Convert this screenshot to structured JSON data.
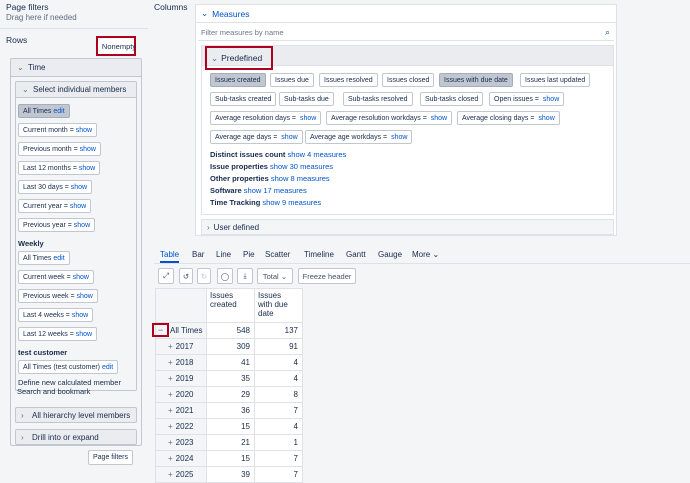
{
  "left": {
    "page_filters_title": "Page filters",
    "page_filters_hint": "Drag here if needed",
    "rows_title": "Rows",
    "nonempty_label": "Nonempty",
    "time_panel_title": "Time",
    "select_members_title": "Select individual members",
    "members": {
      "all_times": "All Times",
      "edit": "edit",
      "show": "show",
      "current_month": "Current month",
      "previous_month": "Previous month",
      "last_12_months": "Last 12 months",
      "last_30_days": "Last 30 days",
      "current_year": "Current year",
      "previous_year": "Previous year",
      "weekly_title": "Weekly",
      "current_week": "Current week",
      "previous_week": "Previous week",
      "last_4_weeks": "Last 4 weeks",
      "last_12_weeks": "Last 12 weeks",
      "test_customer_title": "test customer",
      "all_times_test_customer": "All Times (test customer)",
      "define_calc": "Define new calculated member",
      "search_bookmark": "Search and bookmark"
    },
    "all_hierarchy": "All hierarchy level members",
    "drill": "Drill into or expand",
    "page_filters_button": "Page filters"
  },
  "columns_label": "Columns",
  "measures": {
    "title": "Measures",
    "filter_placeholder": "Filter measures by name",
    "predefined_title": "Predefined",
    "show": "show",
    "chips": {
      "issues_created": "Issues created",
      "issues_due": "Issues due",
      "issues_resolved": "Issues resolved",
      "issues_closed": "Issues closed",
      "issues_with_due_date": "Issues with due date",
      "issues_last_updated": "Issues last updated",
      "subtasks_created": "Sub-tasks created",
      "subtasks_due": "Sub-tasks due",
      "subtasks_resolved": "Sub-tasks resolved",
      "subtasks_closed": "Sub-tasks closed",
      "open_issues": "Open issues",
      "avg_resolution_days": "Average resolution days",
      "avg_resolution_workdays": "Average resolution workdays",
      "avg_closing_days": "Average closing days",
      "avg_age_days": "Average age days",
      "avg_age_workdays": "Average age workdays"
    },
    "groups": [
      {
        "label": "Distinct issues count",
        "link": "show 4 measures"
      },
      {
        "label": "Issue properties",
        "link": "show 30 measures"
      },
      {
        "label": "Other properties",
        "link": "show 8 measures"
      },
      {
        "label": "Software",
        "link": "show 17 measures"
      },
      {
        "label": "Time Tracking",
        "link": "show 9 measures"
      }
    ],
    "user_defined_title": "User defined"
  },
  "tabs": [
    "Table",
    "Bar",
    "Line",
    "Pie",
    "Scatter",
    "Timeline",
    "Gantt",
    "Gauge",
    "More"
  ],
  "toolbar": {
    "total_label": "Total",
    "freeze_header": "Freeze header"
  },
  "table": {
    "col_headers": [
      "Issues\ncreated",
      "Issues\nwith due\ndate"
    ],
    "col1": "Issues created",
    "col2": "Issues with due date",
    "rows": [
      {
        "label": "All Times",
        "created": "548",
        "due": "137"
      },
      {
        "label": "2017",
        "created": "309",
        "due": "91"
      },
      {
        "label": "2018",
        "created": "41",
        "due": "4"
      },
      {
        "label": "2019",
        "created": "35",
        "due": "4"
      },
      {
        "label": "2020",
        "created": "29",
        "due": "8"
      },
      {
        "label": "2021",
        "created": "36",
        "due": "7"
      },
      {
        "label": "2022",
        "created": "15",
        "due": "4"
      },
      {
        "label": "2023",
        "created": "21",
        "due": "1"
      },
      {
        "label": "2024",
        "created": "15",
        "due": "7"
      },
      {
        "label": "2025",
        "created": "39",
        "due": "7"
      }
    ]
  },
  "colors": {
    "accent": "#0052cc",
    "highlight": "#b00020"
  }
}
